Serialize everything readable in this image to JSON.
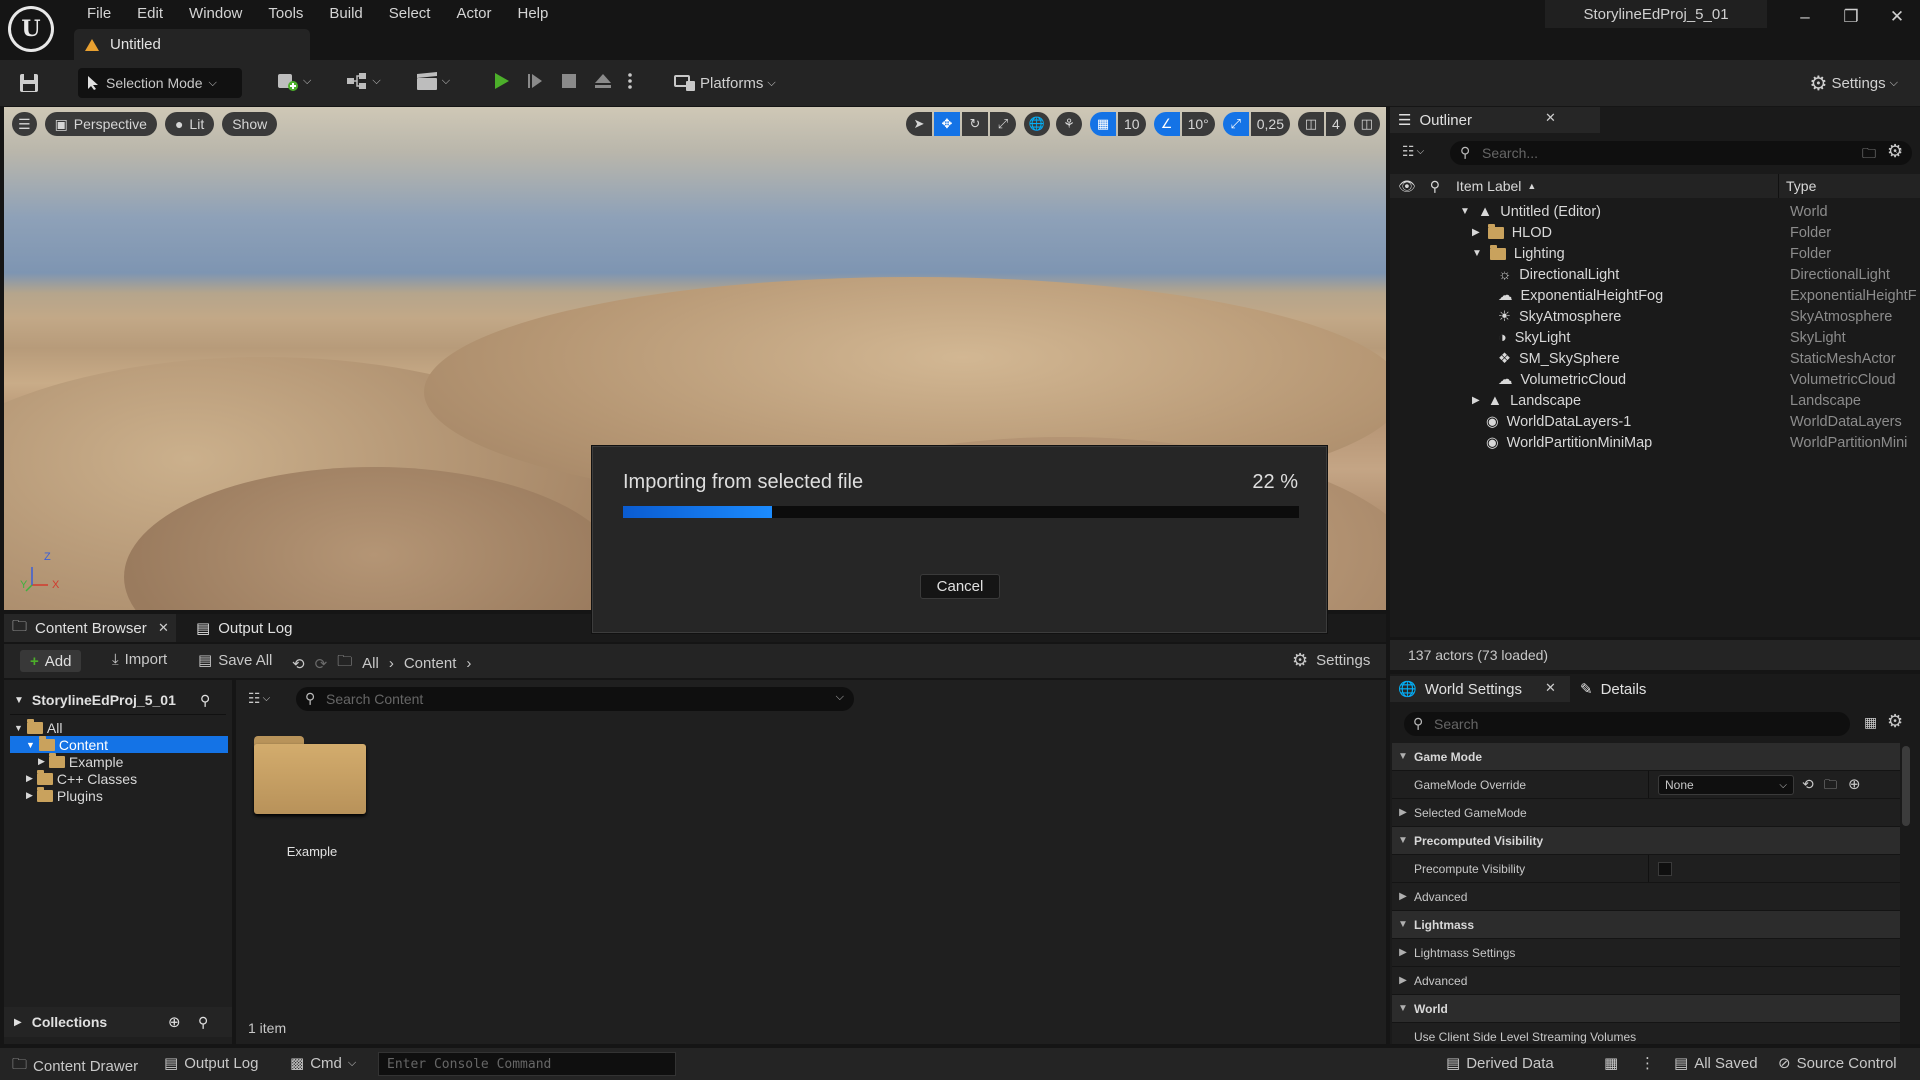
{
  "app": {
    "menu": [
      "File",
      "Edit",
      "Window",
      "Tools",
      "Build",
      "Select",
      "Actor",
      "Help"
    ],
    "document_tab": "Untitled",
    "project_name": "StorylineEdProj_5_01"
  },
  "toolbar": {
    "selection_mode": "Selection Mode",
    "platforms": "Platforms",
    "settings": "Settings"
  },
  "viewport": {
    "perspective": "Perspective",
    "lit": "Lit",
    "show": "Show",
    "grid_snap": "10",
    "rotation_snap": "10°",
    "scale_snap": "0,25",
    "camera_speed": "4",
    "axis_z": "Z",
    "axis_y": "Y",
    "axis_x": "X"
  },
  "outliner": {
    "title": "Outliner",
    "search_placeholder": "Search...",
    "col_label": "Item Label",
    "col_type": "Type",
    "rows": [
      {
        "label": "Untitled (Editor)",
        "type": "World"
      },
      {
        "label": "HLOD",
        "type": "Folder"
      },
      {
        "label": "Lighting",
        "type": "Folder"
      },
      {
        "label": "DirectionalLight",
        "type": "DirectionalLight"
      },
      {
        "label": "ExponentialHeightFog",
        "type": "ExponentialHeightF"
      },
      {
        "label": "SkyAtmosphere",
        "type": "SkyAtmosphere"
      },
      {
        "label": "SkyLight",
        "type": "SkyLight"
      },
      {
        "label": "SM_SkySphere",
        "type": "StaticMeshActor"
      },
      {
        "label": "VolumetricCloud",
        "type": "VolumetricCloud"
      },
      {
        "label": "Landscape",
        "type": "Landscape"
      },
      {
        "label": "WorldDataLayers-1",
        "type": "WorldDataLayers"
      },
      {
        "label": "WorldPartitionMiniMap",
        "type": "WorldPartitionMini"
      }
    ],
    "status": "137 actors (73 loaded)"
  },
  "world_settings": {
    "tab_world": "World Settings",
    "tab_details": "Details",
    "search_placeholder": "Search",
    "rows": [
      {
        "label": "Game Mode",
        "kind": "category"
      },
      {
        "label": "GameMode Override",
        "kind": "prop",
        "value": "None"
      },
      {
        "label": "Selected GameMode",
        "kind": "sub"
      },
      {
        "label": "Precomputed Visibility",
        "kind": "category"
      },
      {
        "label": "Precompute Visibility",
        "kind": "prop"
      },
      {
        "label": "Advanced",
        "kind": "sub"
      },
      {
        "label": "Lightmass",
        "kind": "category"
      },
      {
        "label": "Lightmass Settings",
        "kind": "sub"
      },
      {
        "label": "Advanced",
        "kind": "sub"
      },
      {
        "label": "World",
        "kind": "category"
      },
      {
        "label": "Use Client Side Level Streaming Volumes",
        "kind": "prop"
      }
    ]
  },
  "content_browser": {
    "tab_content": "Content Browser",
    "tab_output": "Output Log",
    "add": "Add",
    "import": "Import",
    "save_all": "Save All",
    "crumb_all": "All",
    "crumb_content": "Content",
    "settings": "Settings",
    "root": "StorylineEdProj_5_01",
    "tree": [
      "All",
      "Content",
      "Example",
      "C++ Classes",
      "Plugins"
    ],
    "search_placeholder": "Search Content",
    "asset_name": "Example",
    "item_count": "1 item",
    "collections": "Collections"
  },
  "statusbar": {
    "content_drawer": "Content Drawer",
    "output_log": "Output Log",
    "cmd": "Cmd",
    "console_placeholder": "Enter Console Command",
    "derived_data": "Derived Data",
    "all_saved": "All Saved",
    "source_control": "Source Control"
  },
  "modal": {
    "title": "Importing from selected file",
    "percent_label": "22 %",
    "progress": 0.22,
    "cancel": "Cancel"
  },
  "colors": {
    "accent_blue": "#1473e6",
    "play_green": "#4caf2a",
    "folder": "#c9a25d"
  }
}
